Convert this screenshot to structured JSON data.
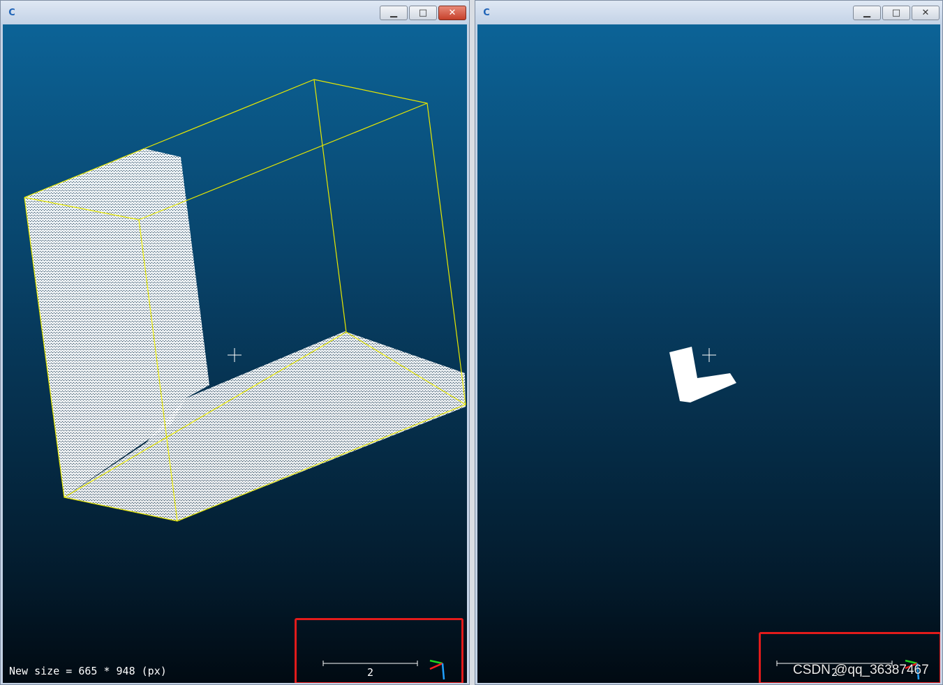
{
  "left_window": {
    "icon": "cloudcompare-icon",
    "status_text": "New size = 665 * 948 (px)",
    "scale_label": "2",
    "buttons": {
      "minimize": "▁",
      "maximize": "□",
      "close": "✕"
    }
  },
  "right_window": {
    "icon": "cloudcompare-icon",
    "scale_label": "2",
    "buttons": {
      "minimize": "▁",
      "maximize": "□",
      "close": "✕"
    }
  },
  "watermark": "CSDN @qq_36387467",
  "colors": {
    "bbox": "#e8e800",
    "highlight": "#e21b1b",
    "axis_x": "#ff2020",
    "axis_y": "#20d020",
    "axis_z": "#20a0ff"
  }
}
